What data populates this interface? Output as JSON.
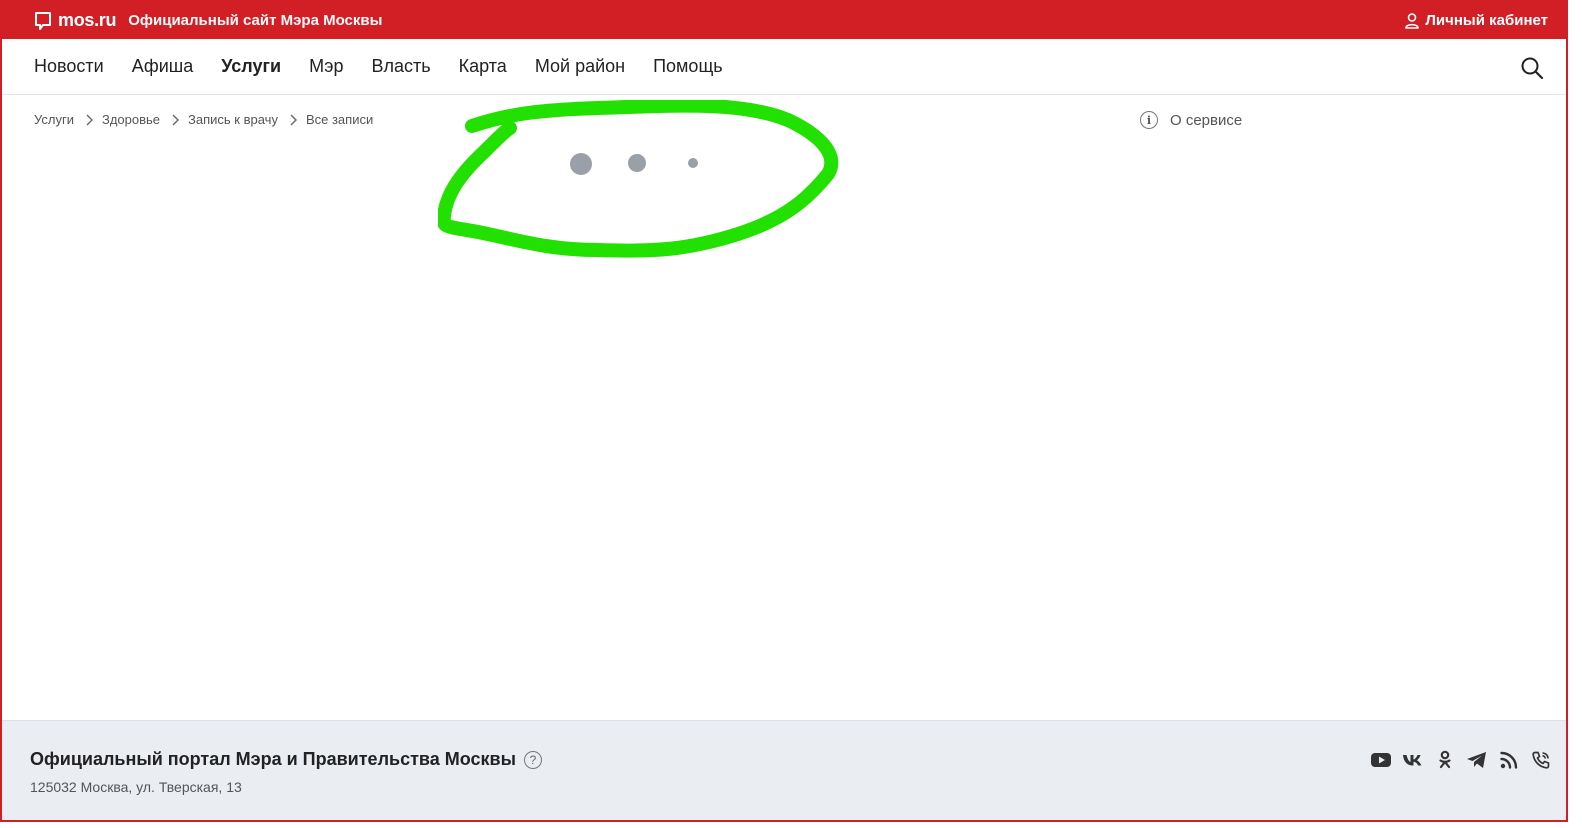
{
  "header": {
    "logo_text": "mos.ru",
    "site_title": "Официальный сайт Мэра Москвы",
    "account_label": "Личный кабинет"
  },
  "nav": {
    "items": [
      {
        "label": "Новости",
        "active": false
      },
      {
        "label": "Афиша",
        "active": false
      },
      {
        "label": "Услуги",
        "active": true
      },
      {
        "label": "Мэр",
        "active": false
      },
      {
        "label": "Власть",
        "active": false
      },
      {
        "label": "Карта",
        "active": false
      },
      {
        "label": "Мой район",
        "active": false
      },
      {
        "label": "Помощь",
        "active": false
      }
    ]
  },
  "breadcrumb": {
    "items": [
      "Услуги",
      "Здоровье",
      "Запись к врачу",
      "Все записи"
    ]
  },
  "about": {
    "icon_text": "i",
    "label": "О сервисе"
  },
  "footer": {
    "title": "Официальный портал Мэра и Правительства Москвы",
    "help_icon_text": "?",
    "address": "125032 Москва, ул. Тверская, 13"
  },
  "colors": {
    "brand_red": "#d21f26",
    "loader_dot": "#9aa0a8",
    "annotation_green": "#22e000",
    "footer_bg": "#eaedf2"
  },
  "icons": [
    "speech-bubble-logo-icon",
    "user-icon",
    "search-icon",
    "chevron-right-icon",
    "info-icon",
    "help-icon",
    "youtube-icon",
    "vk-icon",
    "odnoklassniki-icon",
    "telegram-icon",
    "rss-icon",
    "phone-icon"
  ]
}
